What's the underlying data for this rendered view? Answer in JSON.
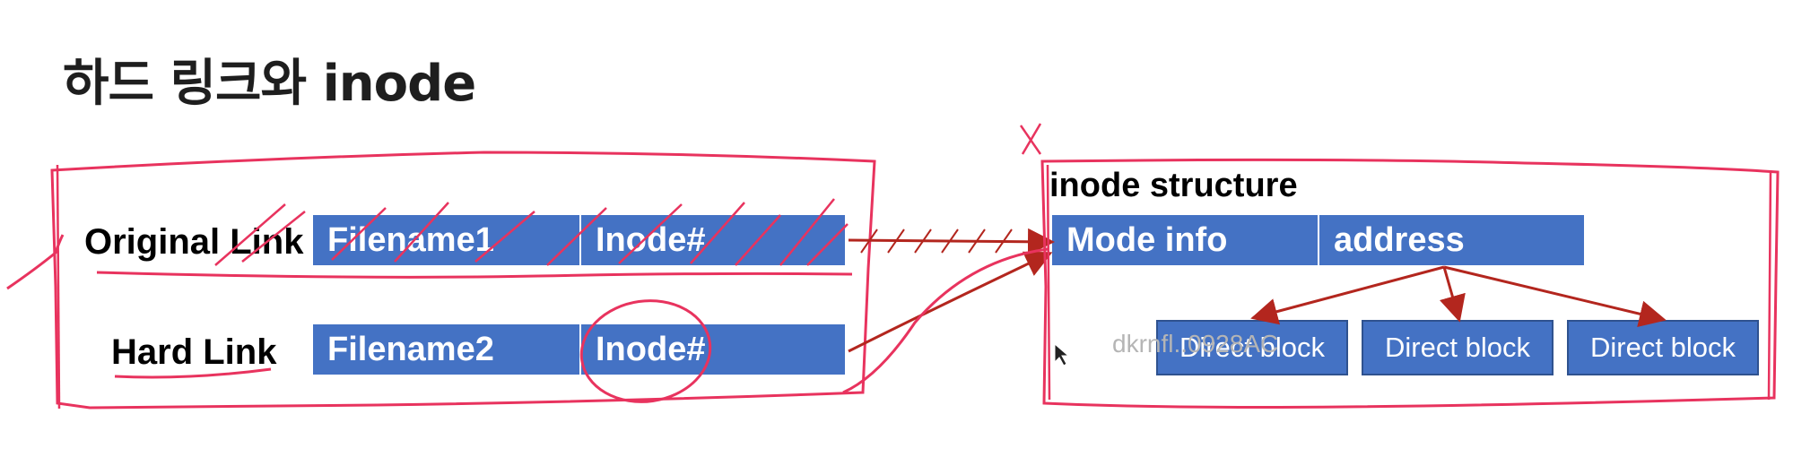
{
  "title": "하드 링크와 inode",
  "left_panel": {
    "original_link": {
      "label": "Original Link",
      "filename": "Filename1",
      "inode": "Inode#"
    },
    "hard_link": {
      "label": "Hard Link",
      "filename": "Filename2",
      "inode": "Inode#"
    }
  },
  "right_panel": {
    "heading": "inode structure",
    "mode_info": "Mode info",
    "address": "address",
    "blocks": [
      "Direct block",
      "Direct block",
      "Direct block"
    ],
    "watermark": "dkrnfl..0928AC"
  },
  "annotations": {
    "cross_mark": "X"
  },
  "colors": {
    "cell_fill": "#4472c4",
    "annotation_pink": "#e8335e",
    "arrow_red": "#b3261e"
  }
}
